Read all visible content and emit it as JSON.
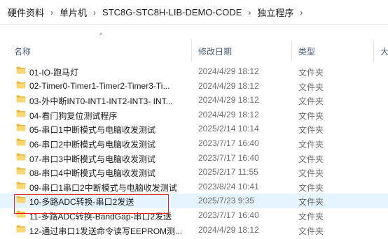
{
  "breadcrumb": {
    "items": [
      "硬件资料",
      "单片机",
      "STC8G-STC8H-LIB-DEMO-CODE",
      "独立程序"
    ],
    "separator": "›"
  },
  "columns": {
    "name": "名称",
    "date": "修改日期",
    "type": "类型",
    "size": "大"
  },
  "sort_arrow": "^",
  "files": [
    {
      "name": "01-IO-跑马灯",
      "date": "2024/4/29 18:12",
      "type": "文件夹"
    },
    {
      "name": "02-Timer0-Timer1-Timer2-Timer3-Ti...",
      "date": "2024/4/29 18:12",
      "type": "文件夹"
    },
    {
      "name": "03-外中断INT0-INT1-INT2-INT3- INT...",
      "date": "2024/4/29 18:12",
      "type": "文件夹"
    },
    {
      "name": "04-看门狗复位测试程序",
      "date": "2024/4/29 18:12",
      "type": "文件夹"
    },
    {
      "name": "05-串口1中断模式与电脑收发测试",
      "date": "2025/2/14 10:14",
      "type": "文件夹"
    },
    {
      "name": "06-串口2中断模式与电脑收发测试",
      "date": "2023/7/17 16:40",
      "type": "文件夹"
    },
    {
      "name": "07-串口3中断模式与电脑收发测试",
      "date": "2023/7/17 16:40",
      "type": "文件夹"
    },
    {
      "name": "08-串口4中断模式与电脑收发测试",
      "date": "2025/2/17 11:55",
      "type": "文件夹"
    },
    {
      "name": "09-串口1串口2中断模式与电脑收发测试",
      "date": "2023/8/24 10:41",
      "type": "文件夹"
    },
    {
      "name": "10-多路ADC转换-串口2发送",
      "date": "2025/7/23 9:35",
      "type": "文件夹"
    },
    {
      "name": "11-多路ADC转换-BandGap-串口2发送",
      "date": "2023/7/17 16:40",
      "type": "文件夹"
    },
    {
      "name": "12-通过串口1发送命令读写EEPROM测...",
      "date": "2024/4/29 18:12",
      "type": "文件夹"
    }
  ],
  "highlighted_index": 9,
  "colors": {
    "highlight_row": "#e5f3ff",
    "annotation_box": "#e0262b",
    "folder_yellow": "#f8d775"
  }
}
